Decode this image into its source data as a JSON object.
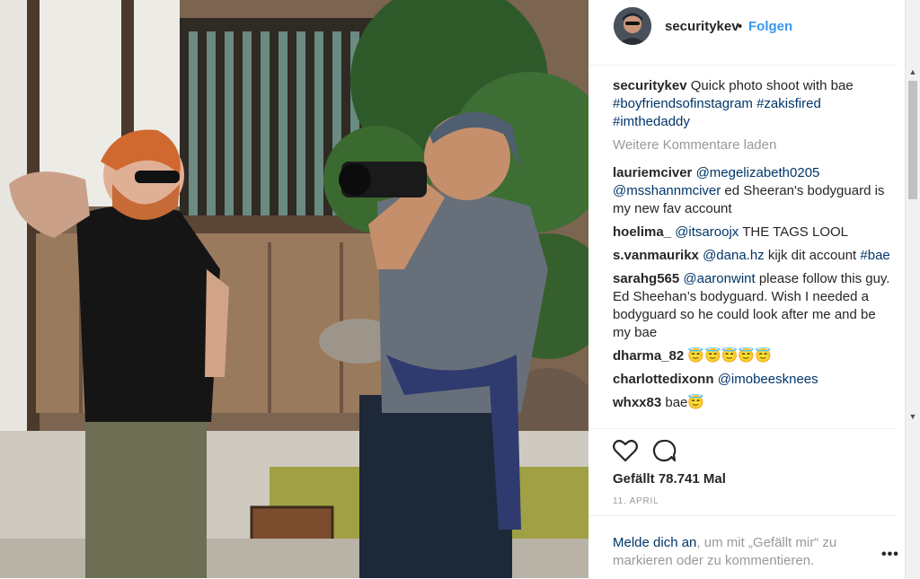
{
  "post": {
    "username": "securitykev",
    "dot": "•",
    "follow_label": "Folgen",
    "caption": {
      "user": "securitykev",
      "text": " Quick photo shoot with bae ",
      "tags": [
        "#boyfriendsofinstagram",
        "#zakisfired",
        "#imthedaddy"
      ]
    },
    "load_more": "Weitere Kommentare laden",
    "comments": [
      {
        "user": "lauriemciver",
        "mention": "@megelizabeth0205",
        "mention2": "@msshannmciver",
        "text": " ed Sheeran's bodyguard is my new fav account"
      },
      {
        "user": "hoelima_",
        "mention": "@itsaroojx",
        "text": " THE TAGS LOOL"
      },
      {
        "user": "s.vanmaurikx",
        "mention": "@dana.hz",
        "text": " kijk dit account ",
        "tag": "#bae"
      },
      {
        "user": "sarahg565",
        "mention": "@aaronwint",
        "text": " please follow this guy. Ed Sheehan’s bodyguard. Wish I needed a bodyguard so he could look after me and be my bae"
      },
      {
        "user": "dharma_82",
        "text": "😇😇😇😇😇"
      },
      {
        "user": "charlottedixonn",
        "mention": "@imobeesknees"
      },
      {
        "user": "whxx83",
        "text": "bae😇"
      }
    ],
    "likes": "Gefällt 78.741 Mal",
    "date": "11. APRIL",
    "login_link": "Melde dich an",
    "login_text": ", um mit „Gefällt mir“ zu markieren oder zu kommentieren.",
    "ellipsis": "•••"
  },
  "icons": {
    "heart": "heart-outline-icon",
    "comment": "speech-bubble-icon",
    "scroll_up": "▲",
    "scroll_down": "▼"
  },
  "colors": {
    "link": "#3897f0",
    "tag": "#003569",
    "muted": "#999999"
  }
}
